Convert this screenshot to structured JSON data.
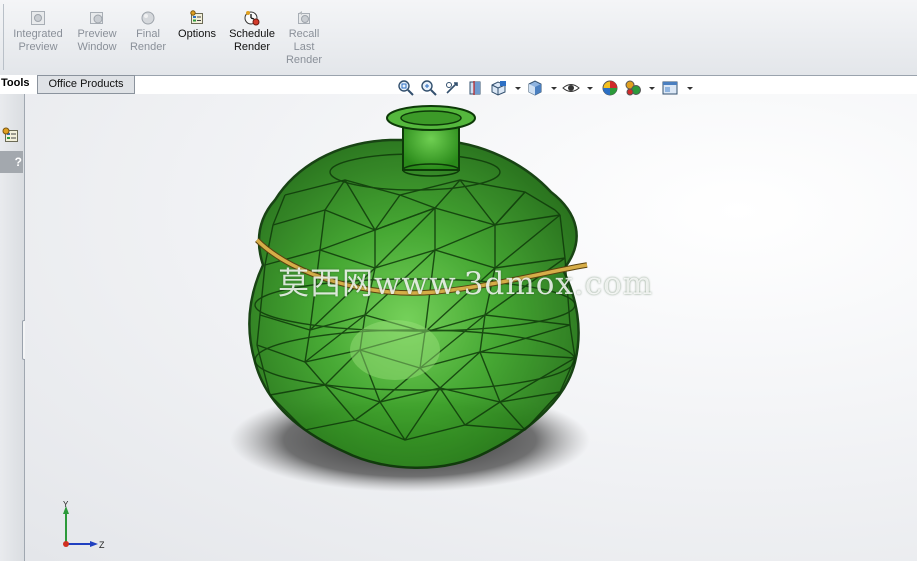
{
  "ribbon": {
    "buttons": [
      {
        "label_line1": "Integrated",
        "label_line2": "Preview",
        "label_line3": "",
        "icon": "integrated-preview-icon",
        "enabled": false
      },
      {
        "label_line1": "Preview",
        "label_line2": "Window",
        "label_line3": "",
        "icon": "preview-window-icon",
        "enabled": false
      },
      {
        "label_line1": "Final",
        "label_line2": "Render",
        "label_line3": "",
        "icon": "final-render-icon",
        "enabled": false
      },
      {
        "label_line1": "Options",
        "label_line2": "",
        "label_line3": "",
        "icon": "options-icon",
        "enabled": true
      },
      {
        "label_line1": "Schedule",
        "label_line2": "Render",
        "label_line3": "",
        "icon": "schedule-render-icon",
        "enabled": true
      },
      {
        "label_line1": "Recall",
        "label_line2": "Last",
        "label_line3": "Render",
        "icon": "recall-last-render-icon",
        "enabled": false
      }
    ]
  },
  "tabs": {
    "active": "Tools",
    "inactive": "Office Products"
  },
  "side_panel": {
    "help_label": "?",
    "icons": [
      "render-tools-icon"
    ]
  },
  "view_toolbar": {
    "icons": [
      "zoom-to-fit-icon",
      "zoom-to-area-icon",
      "previous-view-icon",
      "section-view-icon",
      "view-orientation-icon",
      "display-style-icon",
      "hide-show-items-icon",
      "edit-appearance-icon",
      "apply-scene-icon",
      "view-settings-icon"
    ]
  },
  "viewport": {
    "watermark": "莫西网www.3dmox.com",
    "triad_labels": {
      "x": "Z",
      "y": "Y"
    }
  },
  "colors": {
    "model_green": "#2e8a1e",
    "model_edge": "#0d3a08",
    "band_gold": "#c8a040",
    "shadow": "#3a3a3a"
  }
}
